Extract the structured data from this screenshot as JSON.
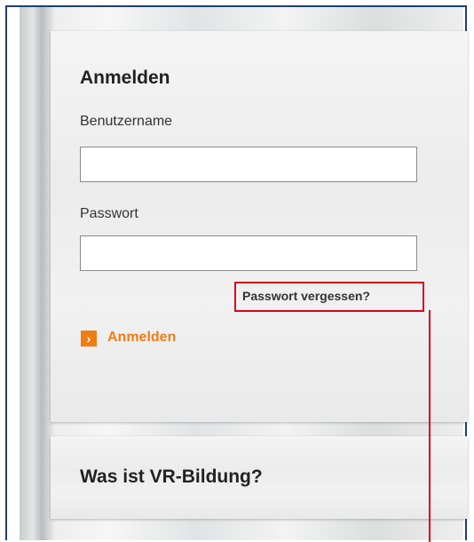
{
  "login": {
    "title": "Anmelden",
    "username_label": "Benutzername",
    "username_value": "",
    "password_label": "Passwort",
    "password_value": "",
    "forgot_password": "Passwort vergessen?",
    "submit_label": "Anmelden",
    "submit_icon": "chevron-right-icon"
  },
  "info": {
    "title": "Was ist VR-Bildung?"
  },
  "colors": {
    "accent": "#f07c14",
    "highlight": "#d9001b",
    "frame_border": "#1f3f73"
  }
}
